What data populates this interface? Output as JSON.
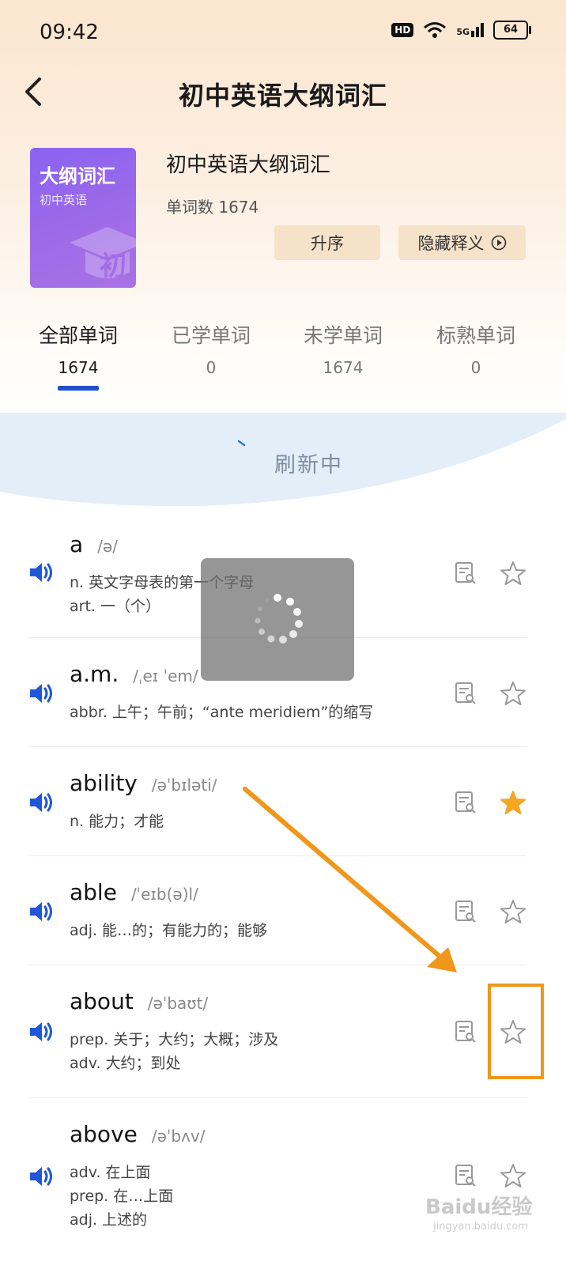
{
  "status_bar": {
    "time": "09:42",
    "network_badge": "HD",
    "signal": "5G",
    "battery": "64"
  },
  "nav": {
    "title": "初中英语大纲词汇",
    "back_icon": "chevron-left-icon"
  },
  "book": {
    "cover_title": "大纲词汇",
    "cover_subtitle": "初中英语",
    "cover_mark": "初",
    "name": "初中英语大纲词汇",
    "word_count": "单词数 1674",
    "sort_button": "升序",
    "hide_button": "隐藏释义"
  },
  "tabs": [
    {
      "label": "全部单词",
      "count": "1674"
    },
    {
      "label": "已学单词",
      "count": "0"
    },
    {
      "label": "未学单词",
      "count": "1674"
    },
    {
      "label": "标熟单词",
      "count": "0"
    }
  ],
  "refresh": {
    "text": "刷新中"
  },
  "words": [
    {
      "word": "a",
      "phonetic": "/ə/",
      "defs": [
        "n. 英文字母表的第一个字母",
        "art. 一（个）"
      ],
      "starred": false
    },
    {
      "word": "a.m.",
      "phonetic": "/ˌeɪ ˈem/",
      "defs": [
        "abbr. 上午；午前；“ante meridiem”的缩写"
      ],
      "starred": false
    },
    {
      "word": "ability",
      "phonetic": "/əˈbɪləti/",
      "defs": [
        "n. 能力；才能"
      ],
      "starred": true
    },
    {
      "word": "able",
      "phonetic": "/ˈeɪb(ə)l/",
      "defs": [
        "adj. 能…的；有能力的；能够"
      ],
      "starred": false
    },
    {
      "word": "about",
      "phonetic": "/əˈbaʊt/",
      "defs": [
        "prep. 关于；大约；大概；涉及",
        "adv. 大约；到处"
      ],
      "starred": false
    },
    {
      "word": "above",
      "phonetic": "/əˈbʌv/",
      "defs": [
        "adv. 在上面",
        "prep. 在…上面",
        "adj. 上述的"
      ],
      "starred": false
    }
  ],
  "watermark": {
    "text": "Baidu经验",
    "sub": "jingyan.baidu.com"
  },
  "colors": {
    "accent": "#2051c7",
    "star_active": "#f5a623",
    "annotation": "#f0961b",
    "speaker": "#1f57d6"
  }
}
